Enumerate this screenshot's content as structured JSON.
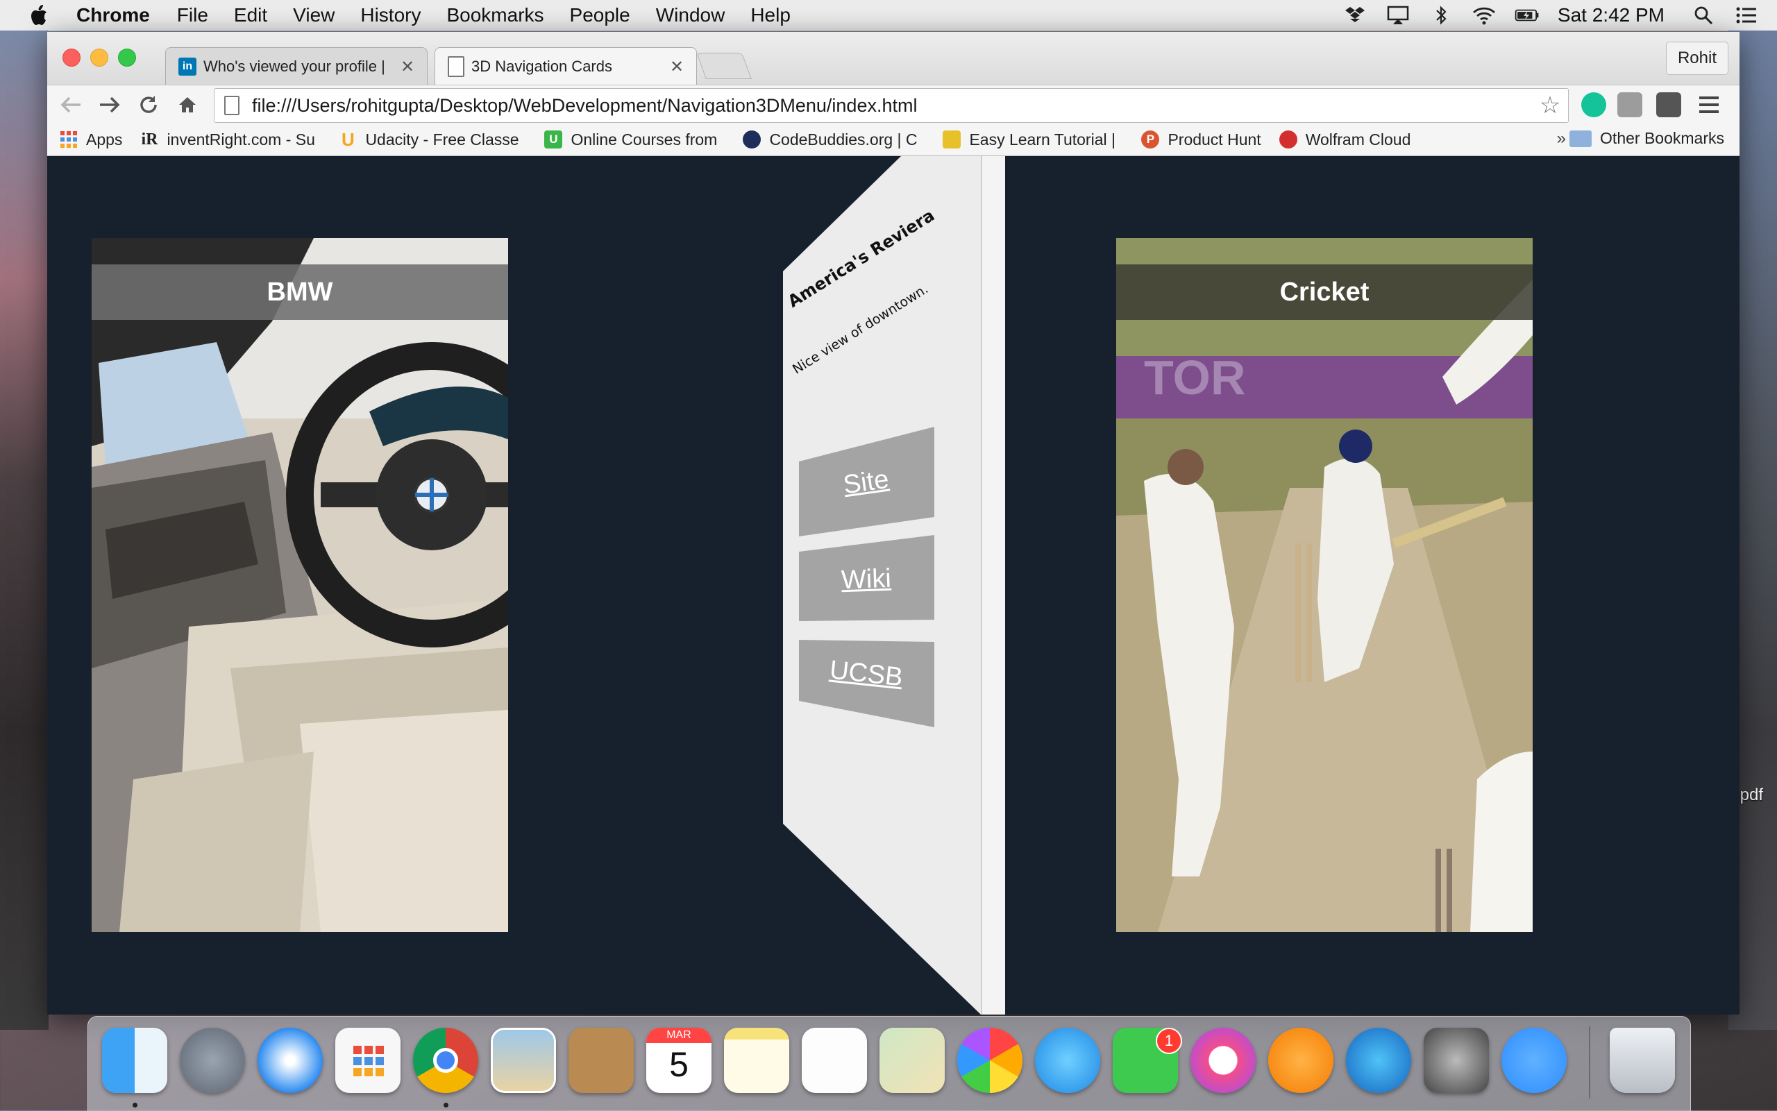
{
  "menubar": {
    "app_name": "Chrome",
    "menus": [
      "File",
      "Edit",
      "View",
      "History",
      "Bookmarks",
      "People",
      "Window",
      "Help"
    ],
    "clock": "Sat 2:42 PM",
    "status_icons": [
      "dropbox-icon",
      "airplay-icon",
      "bluetooth-icon",
      "wifi-icon",
      "battery-icon",
      "spotlight-icon",
      "notification-center-icon"
    ]
  },
  "browser": {
    "tabs": [
      {
        "title": "Who's viewed your profile |",
        "favicon": "linkedin-icon",
        "favicon_text": "in",
        "active": false
      },
      {
        "title": "3D Navigation Cards",
        "favicon": "page-icon",
        "favicon_text": "",
        "active": true
      }
    ],
    "profile": "Rohit",
    "url": "file:///Users/rohitgupta/Desktop/WebDevelopment/Navigation3DMenu/index.html",
    "bookmarks": [
      {
        "label": "Apps",
        "icon": "apps-grid-icon",
        "icon_text": "",
        "color": "#e94e3c"
      },
      {
        "label": "inventRight.com - Su",
        "icon": "inventright-icon",
        "icon_text": "iR",
        "color": "#222222"
      },
      {
        "label": "Udacity - Free Classe",
        "icon": "udacity-icon",
        "icon_text": "U",
        "color": "#f7a51b"
      },
      {
        "label": "Online Courses from",
        "icon": "udemy-icon",
        "icon_text": "U",
        "color": "#3ab54a"
      },
      {
        "label": "CodeBuddies.org | C",
        "icon": "codebuddies-icon",
        "icon_text": "",
        "color": "#1f2d5a"
      },
      {
        "label": "Easy Learn Tutorial |",
        "icon": "easylearn-icon",
        "icon_text": "",
        "color": "#e7c12a"
      },
      {
        "label": "Product Hunt",
        "icon": "producthunt-icon",
        "icon_text": "P",
        "color": "#da552f"
      },
      {
        "label": "Wolfram Cloud",
        "icon": "wolfram-icon",
        "icon_text": "",
        "color": "#d32f2f"
      }
    ],
    "more": "»",
    "other_bookmarks": "Other Bookmarks"
  },
  "page": {
    "cards": [
      {
        "title": "BMW",
        "image": "car-interior-photo"
      },
      {
        "title": "Cricket",
        "image": "cricket-match-photo"
      }
    ],
    "panel": {
      "heading": "America's Reviera",
      "subtext": "Nice view of downtown.",
      "links": [
        "Site",
        "Wiki",
        "UCSB"
      ]
    }
  },
  "desktop": {
    "file_label": ".pdf"
  },
  "dock": {
    "apps": [
      "finder-icon",
      "launchpad-icon",
      "safari-icon",
      "apps-grid-icon",
      "chrome-icon",
      "mail-icon",
      "contacts-icon",
      "calendar-icon",
      "notes-icon",
      "reminders-icon",
      "maps-icon",
      "photos-icon",
      "messages-icon",
      "facetime-icon",
      "itunes-icon",
      "ibooks-icon",
      "app-store-icon",
      "system-preferences-icon",
      "zoom-icon",
      "trash-icon"
    ],
    "calendar_month": "MAR",
    "calendar_day": "5",
    "facetime_badge": "1"
  },
  "colors": {
    "page_bg": "#17212d",
    "panel_face": "#ececec",
    "panel_button": "#a4a4a4"
  }
}
